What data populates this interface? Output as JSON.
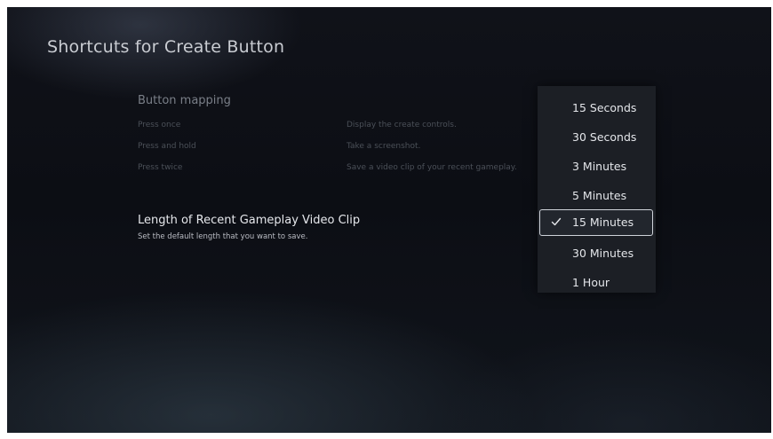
{
  "header": {
    "title": "Shortcuts for Create Button"
  },
  "button_mapping": {
    "heading": "Button mapping",
    "rows": [
      {
        "label": "Press once",
        "value": "Display the create controls."
      },
      {
        "label": "Press and hold",
        "value": "Take a screenshot."
      },
      {
        "label": "Press twice",
        "value": "Save a video clip of your recent gameplay."
      }
    ]
  },
  "clip_length": {
    "title": "Length of Recent Gameplay Video Clip",
    "description": "Set the default length that you want to save."
  },
  "dropdown": {
    "selected_index": 4,
    "options": [
      {
        "label": "15 Seconds"
      },
      {
        "label": "30 Seconds"
      },
      {
        "label": "3 Minutes"
      },
      {
        "label": "5 Minutes"
      },
      {
        "label": "15 Minutes"
      },
      {
        "label": "30 Minutes"
      },
      {
        "label": "1 Hour"
      }
    ],
    "selected_icon": "check-icon"
  },
  "colors": {
    "background": "#0e1016",
    "dropdown_background": "#1c1f25",
    "selection_border": "#cfd3da"
  }
}
